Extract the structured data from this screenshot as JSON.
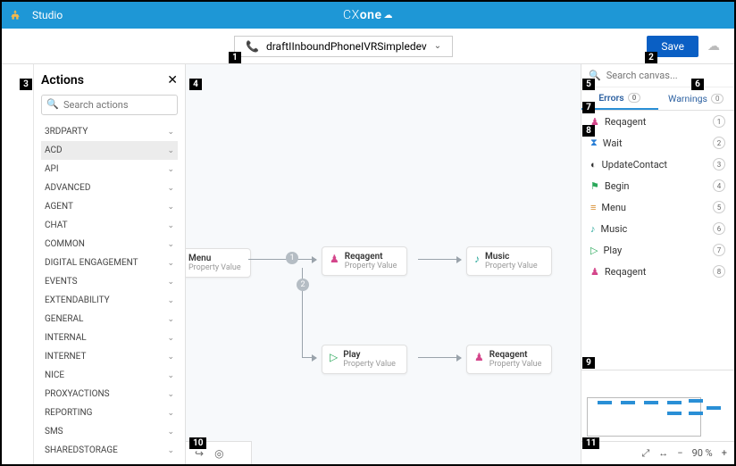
{
  "header": {
    "studio_label": "Studio",
    "logo_text": "CXone"
  },
  "toolbar": {
    "script_name": "draftIInboundPhoneIVRSimpledev",
    "save_label": "Save"
  },
  "actions_panel": {
    "title": "Actions",
    "search_placeholder": "Search actions",
    "categories": [
      "3RDPARTY",
      "ACD",
      "API",
      "ADVANCED",
      "AGENT",
      "CHAT",
      "COMMON",
      "DIGITAL ENGAGEMENT",
      "EVENTS",
      "EXTENDABILITY",
      "GENERAL",
      "INTERNAL",
      "INTERNET",
      "NICE",
      "PROXYACTIONS",
      "REPORTING",
      "SMS",
      "SHAREDSTORAGE"
    ],
    "selected_index": 1
  },
  "canvas": {
    "property_sub": "Property Value",
    "nodes": {
      "menu": "Menu",
      "reqagent": "Reqagent",
      "music": "Music",
      "play": "Play",
      "reqagent2": "Reqagent"
    },
    "edge_labels": [
      "1",
      "2"
    ],
    "footer_icons": [
      "redo",
      "target"
    ]
  },
  "right_panel": {
    "search_placeholder": "Search canvas...",
    "tabs": {
      "errors_label": "Errors",
      "errors_count": "0",
      "warnings_label": "Warnings",
      "warnings_count": "0"
    },
    "items": [
      {
        "icon": "reqagent",
        "label": "Reqagent",
        "idx": "1",
        "color": "ic-pink"
      },
      {
        "icon": "wait",
        "label": "Wait",
        "idx": "2",
        "color": "ic-blue"
      },
      {
        "icon": "update",
        "label": "UpdateContact",
        "idx": "3",
        "color": ""
      },
      {
        "icon": "begin",
        "label": "Begin",
        "idx": "4",
        "color": "ic-green"
      },
      {
        "icon": "menu",
        "label": "Menu",
        "idx": "5",
        "color": "ic-orange"
      },
      {
        "icon": "music",
        "label": "Music",
        "idx": "6",
        "color": "ic-teal"
      },
      {
        "icon": "play",
        "label": "Play",
        "idx": "7",
        "color": "ic-green"
      },
      {
        "icon": "reqagent",
        "label": "Reqagent",
        "idx": "8",
        "color": "ic-pink"
      }
    ],
    "zoom": {
      "percent_label": "90 %"
    }
  },
  "callouts": [
    "1",
    "2",
    "3",
    "4",
    "5",
    "6",
    "7",
    "8",
    "9",
    "10",
    "11"
  ]
}
